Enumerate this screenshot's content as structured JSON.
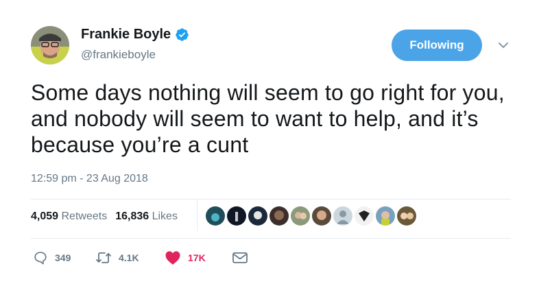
{
  "author": {
    "name": "Frankie Boyle",
    "handle": "@frankieboyle",
    "verified_icon": "verified-badge-icon"
  },
  "follow_button": {
    "label": "Following"
  },
  "tweet": {
    "text": "Some days nothing will seem to go right for you, and nobody will seem to want to help, and it’s because you’re a cunt",
    "timestamp": "12:59 pm - 23 Aug 2018"
  },
  "stats": {
    "retweets_count": "4,059",
    "retweets_label": "Retweets",
    "likes_count": "16,836",
    "likes_label": "Likes"
  },
  "actions": {
    "replies": "349",
    "retweets": "4.1K",
    "likes": "17K"
  },
  "colors": {
    "accent": "#4ca4e8",
    "like": "#e0245e",
    "muted": "#657786"
  }
}
